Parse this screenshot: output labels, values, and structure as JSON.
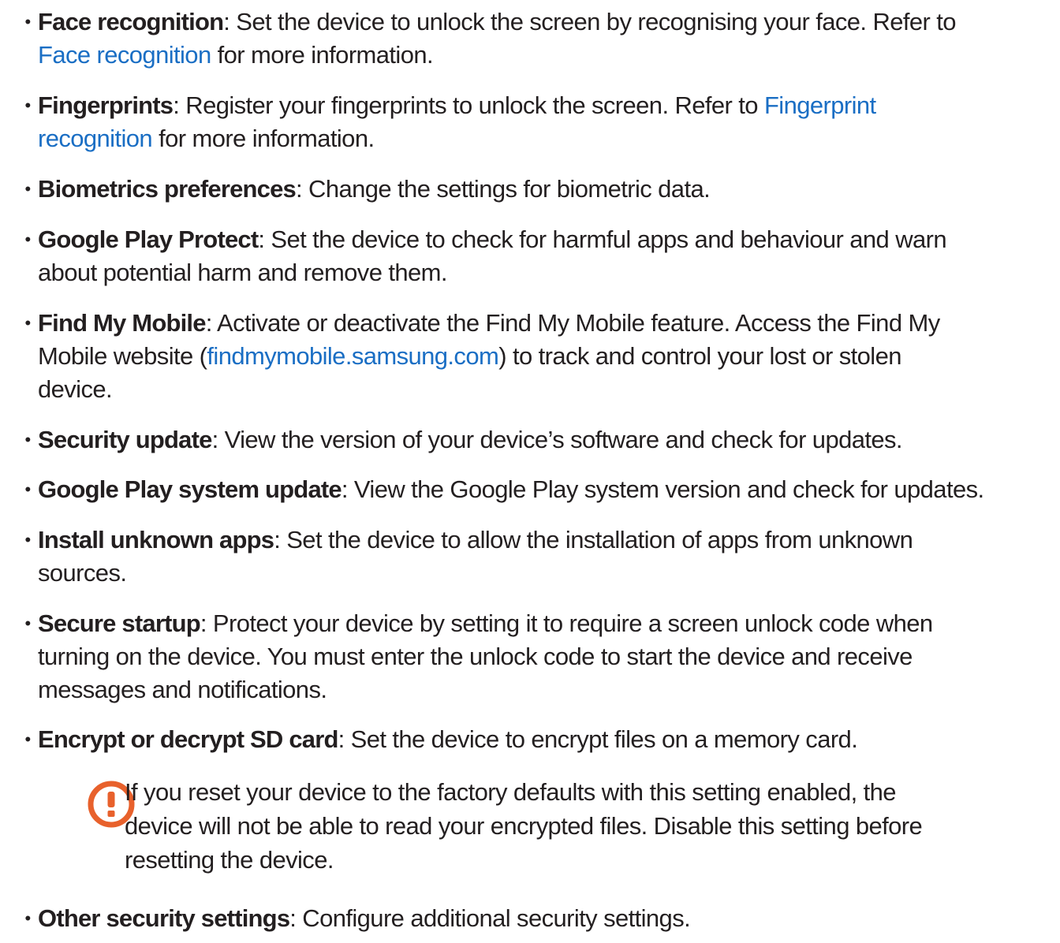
{
  "bullet": "•",
  "items": [
    {
      "term": "Face recognition",
      "line1": ": Set the device to unlock the screen by recognising your face. Refer to",
      "link1": "Face recognition",
      "line2": " for more information."
    },
    {
      "term": "Fingerprints",
      "line1": ": Register your fingerprints to unlock the screen. Refer to ",
      "link1a": "Fingerprint",
      "link1b": "recognition",
      "line2": " for more information."
    },
    {
      "term": "Biometrics preferences",
      "line1": ": Change the settings for biometric data."
    },
    {
      "term": "Google Play Protect",
      "line1": ": Set the device to check for harmful apps and behaviour and warn",
      "line2": "about potential harm and remove them."
    },
    {
      "term": "Find My Mobile",
      "line1": ": Activate or deactivate the Find My Mobile feature. Access the Find My",
      "line2a": "Mobile website (",
      "link": "findmymobile.samsung.com",
      "line2b": ") to track and control your lost or stolen",
      "line3": "device."
    },
    {
      "term": "Security update",
      "line1": ": View the version of your device’s software and check for updates."
    },
    {
      "term": "Google Play system update",
      "line1": ": View the Google Play system version and check for updates."
    },
    {
      "term": "Install unknown apps",
      "line1": ": Set the device to allow the installation of apps from unknown",
      "line2": "sources."
    },
    {
      "term": "Secure startup",
      "line1": ": Protect your device by setting it to require a screen unlock code when",
      "line2": "turning on the device. You must enter the unlock code to start the device and receive",
      "line3": "messages and notifications."
    },
    {
      "term": "Encrypt or decrypt SD card",
      "line1": ": Set the device to encrypt files on a memory card."
    },
    {
      "term": "Other security settings",
      "line1": ": Configure additional security settings."
    }
  ],
  "caution": {
    "icon": "caution-icon",
    "line1": "If you reset your device to the factory defaults with this setting enabled, the",
    "line2": "device will not be able to read your encrypted files. Disable this setting before",
    "line3": "resetting the device."
  },
  "colors": {
    "text": "#231f20",
    "link": "#1a6ec4",
    "caution": "#e8612c"
  }
}
